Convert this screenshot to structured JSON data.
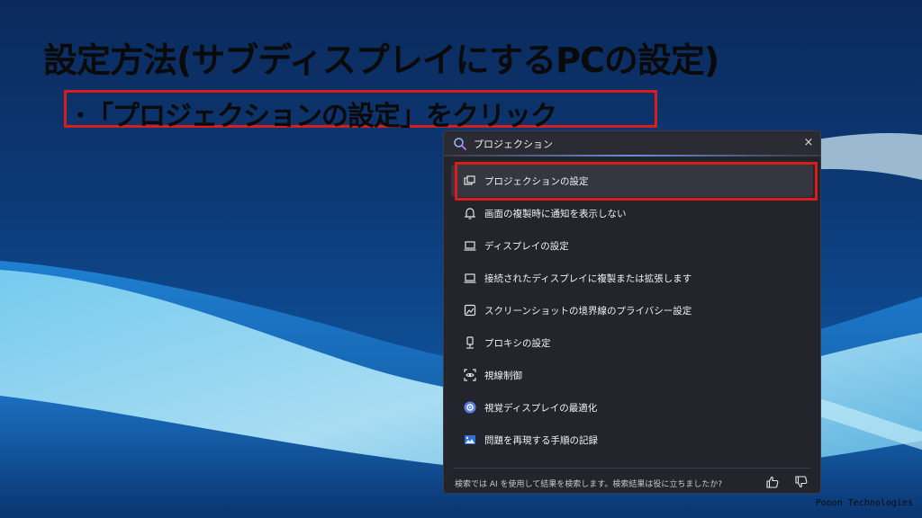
{
  "slide": {
    "title": "設定方法(サブディスプレイにするPCの設定)",
    "instruction": "･「プロジェクションの設定」をクリック",
    "company": "Pooon Technologies"
  },
  "search": {
    "query": "プロジェクション",
    "close_label": "×",
    "results": [
      {
        "icon": "projection-icon",
        "label": "プロジェクションの設定"
      },
      {
        "icon": "bell-icon",
        "label": "画面の複製時に通知を表示しない"
      },
      {
        "icon": "laptop-icon",
        "label": "ディスプレイの設定"
      },
      {
        "icon": "laptop-icon",
        "label": "接続されたディスプレイに複製または拡張します"
      },
      {
        "icon": "screenshot-icon",
        "label": "スクリーンショットの境界線のプライバシー設定"
      },
      {
        "icon": "proxy-icon",
        "label": "プロキシの設定"
      },
      {
        "icon": "eye-control-icon",
        "label": "視線制御"
      },
      {
        "icon": "display-optimize-icon",
        "label": "視覚ディスプレイの最適化"
      },
      {
        "icon": "steps-recorder-icon",
        "label": "問題を再現する手順の記録"
      }
    ],
    "footer": "検索では AI を使用して結果を検索します。検索結果は役に立ちましたか?"
  },
  "colors": {
    "highlight": "#d91c1c",
    "panel": "#23242c"
  }
}
